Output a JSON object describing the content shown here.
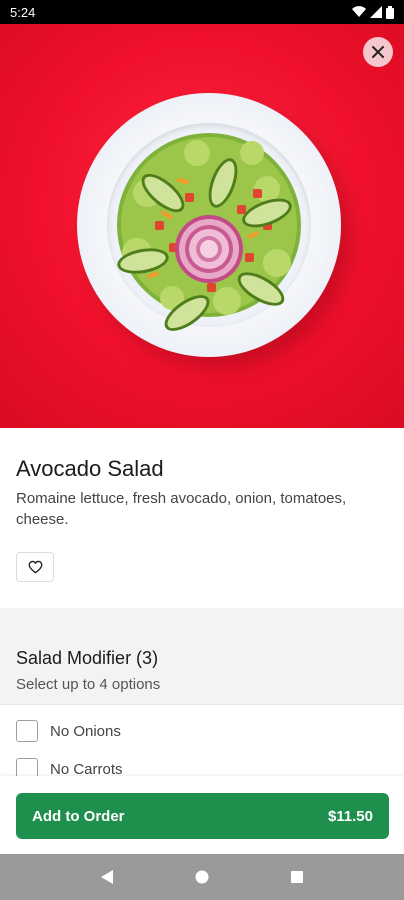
{
  "status_bar": {
    "time": "5:24"
  },
  "item": {
    "name": "Avocado Salad",
    "description": "Romaine lettuce, fresh avocado, onion, tomatoes, cheese."
  },
  "modifier": {
    "title": "Salad Modifier (3)",
    "subtitle": "Select up to 4 options",
    "options": [
      {
        "label": "No Onions",
        "checked": false
      },
      {
        "label": "No Carrots",
        "checked": false
      }
    ]
  },
  "footer": {
    "add_label": "Add to Order",
    "price": "$11.50"
  },
  "colors": {
    "hero_background": "#f0102b",
    "primary_button": "#1f8f4e",
    "close_button_bg": "#f5c6cc"
  },
  "icons": {
    "close": "close-icon",
    "favorite": "heart-icon",
    "nav_back": "back-triangle-icon",
    "nav_home": "home-circle-icon",
    "nav_recents": "recents-square-icon"
  }
}
